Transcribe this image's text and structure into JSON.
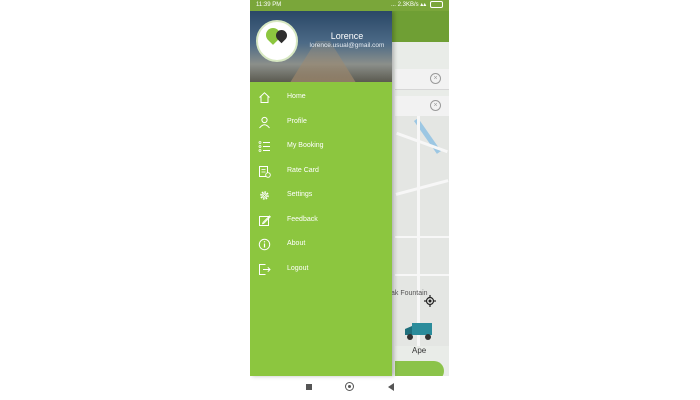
{
  "status_bar": {
    "time": "11:39 PM",
    "network_speed": "... 2.3KB/s",
    "battery_icon": "battery-icon"
  },
  "drawer": {
    "user_name": "Lorence",
    "user_email": "lorence.usual@gmail.com",
    "logo_icon": "app-logo-icon",
    "items": [
      {
        "label": "Home",
        "icon": "home-icon"
      },
      {
        "label": "Profile",
        "icon": "profile-icon"
      },
      {
        "label": "My Booking",
        "icon": "list-icon"
      },
      {
        "label": "Rate Card",
        "icon": "rate-card-icon"
      },
      {
        "label": "Settings",
        "icon": "gear-icon"
      },
      {
        "label": "Feedback",
        "icon": "edit-icon"
      },
      {
        "label": "About",
        "icon": "info-icon"
      },
      {
        "label": "Logout",
        "icon": "logout-icon"
      }
    ]
  },
  "background": {
    "landmark_label": "ak Fountain",
    "vehicle_label": "Ape"
  },
  "colors": {
    "drawer_green": "#8cc63f",
    "header_green": "#6f9f34",
    "status_green": "#7aa63a"
  },
  "nav_bar": {
    "recents_icon": "square-icon",
    "home_icon": "circle-icon",
    "back_icon": "back-triangle-icon"
  }
}
